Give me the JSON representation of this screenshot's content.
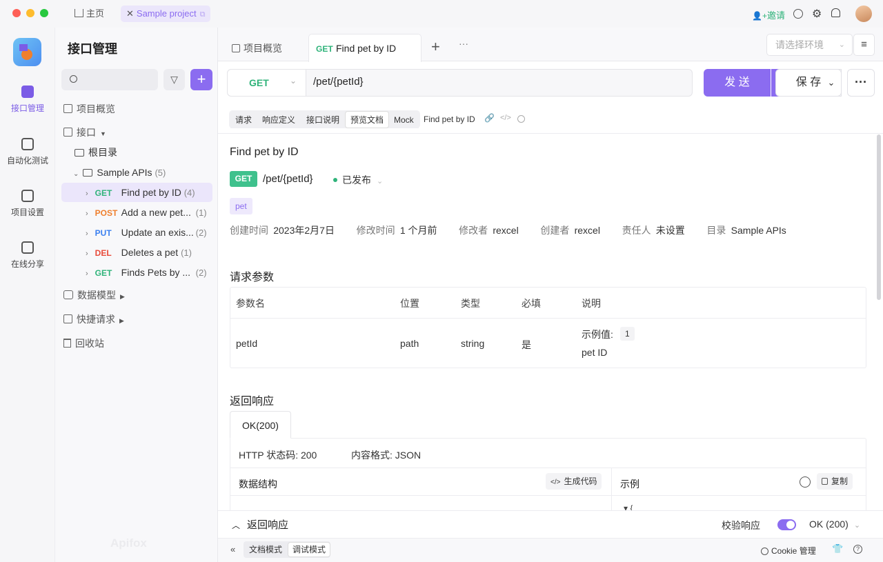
{
  "titlebar": {
    "home_label": "主页",
    "project_tab": "Sample project",
    "invite_label": "邀请"
  },
  "rail": {
    "items": [
      {
        "label": "接口管理",
        "active": true
      },
      {
        "label": "自动化测试"
      },
      {
        "label": "项目设置"
      },
      {
        "label": "在线分享"
      }
    ]
  },
  "tree": {
    "title": "接口管理",
    "search_placeholder": "",
    "overview": "项目概览",
    "apis": "接口",
    "root": "根目录",
    "folder": "Sample APIs",
    "folder_count": "(5)",
    "items": [
      {
        "method": "GET",
        "name": "Find pet by ID",
        "count": "(4)"
      },
      {
        "method": "POST",
        "name": "Add a new pet...",
        "count": "(1)"
      },
      {
        "method": "PUT",
        "name": "Update an exis...",
        "count": "(2)"
      },
      {
        "method": "DEL",
        "name": "Deletes a pet",
        "count": "(1)"
      },
      {
        "method": "GET",
        "name": "Finds Pets by ...",
        "count": "(2)"
      }
    ],
    "models": "数据模型",
    "quick": "快捷请求",
    "trash": "回收站",
    "watermark": "Apifox"
  },
  "tabs": {
    "overview": "项目概览",
    "active_method": "GET",
    "active_name": "Find pet by ID",
    "env_placeholder": "请选择环境"
  },
  "request": {
    "method": "GET",
    "url": "/pet/{petId}",
    "send": "发 送",
    "save": "保 存"
  },
  "subtabs": [
    "请求",
    "响应定义",
    "接口说明",
    "预览文档",
    "Mock"
  ],
  "subtab_title": "Find pet by ID",
  "doc": {
    "title": "Find pet by ID",
    "method": "GET",
    "path": "/pet/{petId}",
    "status": "已发布",
    "tag": "pet",
    "meta": [
      {
        "label": "创建时间",
        "value": "2023年2月7日"
      },
      {
        "label": "修改时间",
        "value": "1 个月前"
      },
      {
        "label": "修改者",
        "value": "rexcel"
      },
      {
        "label": "创建者",
        "value": "rexcel"
      },
      {
        "label": "责任人",
        "value": "未设置"
      },
      {
        "label": "目录",
        "value": "Sample APIs"
      }
    ],
    "params_title": "请求参数",
    "params_headers": [
      "参数名",
      "位置",
      "类型",
      "必填",
      "说明"
    ],
    "param": {
      "name": "petId",
      "location": "path",
      "type": "string",
      "required": "是",
      "example_label": "示例值:",
      "example": "1",
      "desc": "pet ID"
    },
    "response_title": "返回响应",
    "response_tab": "OK(200)",
    "http_status": "HTTP 状态码: 200",
    "content_type": "内容格式: JSON",
    "schema_label": "数据结构",
    "gen_code": "生成代码",
    "example_label": "示例",
    "copy": "复制"
  },
  "bottom_panel": {
    "title": "返回响应",
    "validate": "校验响应",
    "status": "OK (200)"
  },
  "footer": {
    "doc_mode": "文档模式",
    "debug_mode": "调试模式",
    "cookie": "Cookie 管理"
  },
  "colors": {
    "accent": "#8b6cf0",
    "get": "#2fb37a",
    "post": "#ef7f2d",
    "put": "#3a7ff0",
    "del": "#e84a3a"
  }
}
